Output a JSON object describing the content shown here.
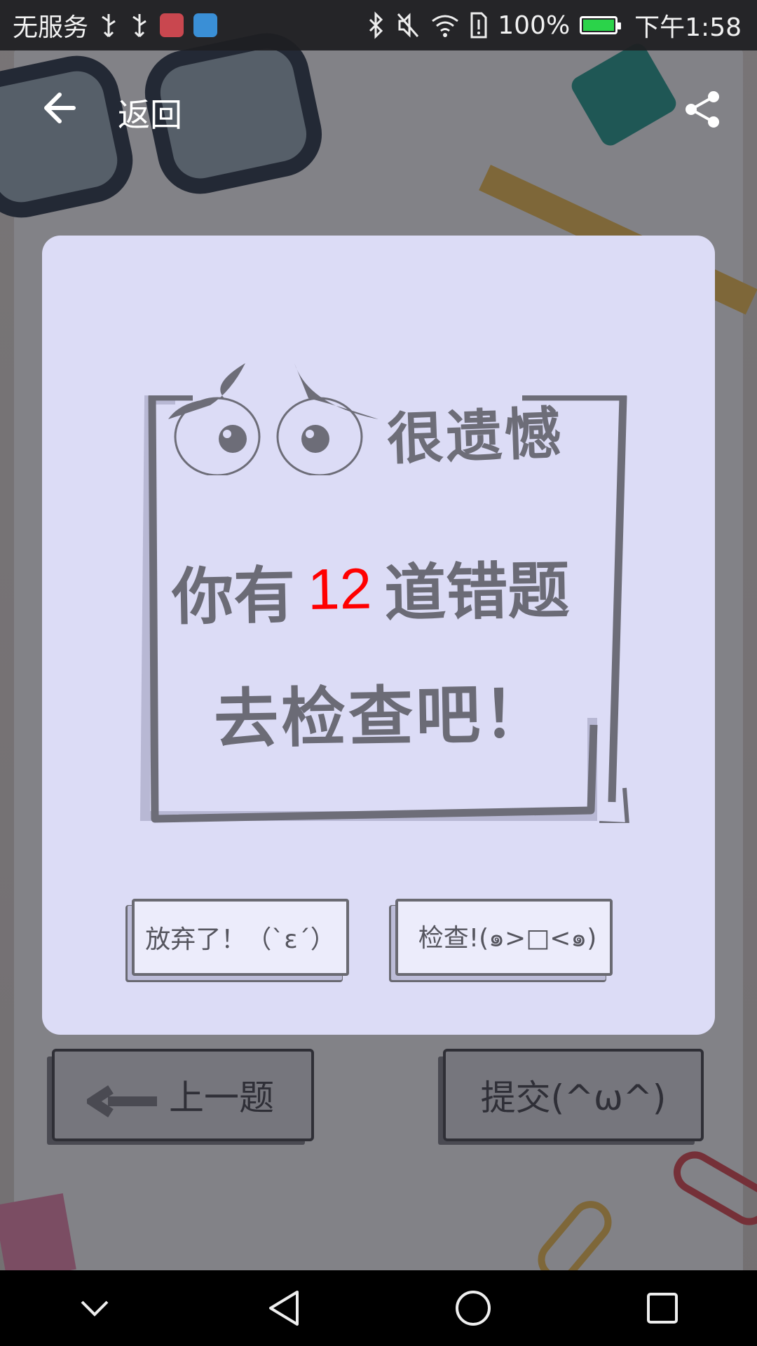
{
  "status_bar": {
    "carrier": "无服务",
    "battery_percent": "100%",
    "time": "下午1:58"
  },
  "top_bar": {
    "back_label": "返回"
  },
  "dialog": {
    "title": "很遗憾",
    "line1_prefix": "你有",
    "wrong_count": "12",
    "line1_suffix": "道错题",
    "line2": "去检查吧！",
    "give_up_label": "放弃了！（`ε´）",
    "check_label": "检查!(๑>□<๑)"
  },
  "bottom_actions": {
    "prev_label": "上一题",
    "submit_label": "提交(^ω^)"
  },
  "colors": {
    "dialog_bg": "#dcdcf6",
    "accent_number": "#ff0000",
    "sketch_text": "#6b6b76"
  }
}
